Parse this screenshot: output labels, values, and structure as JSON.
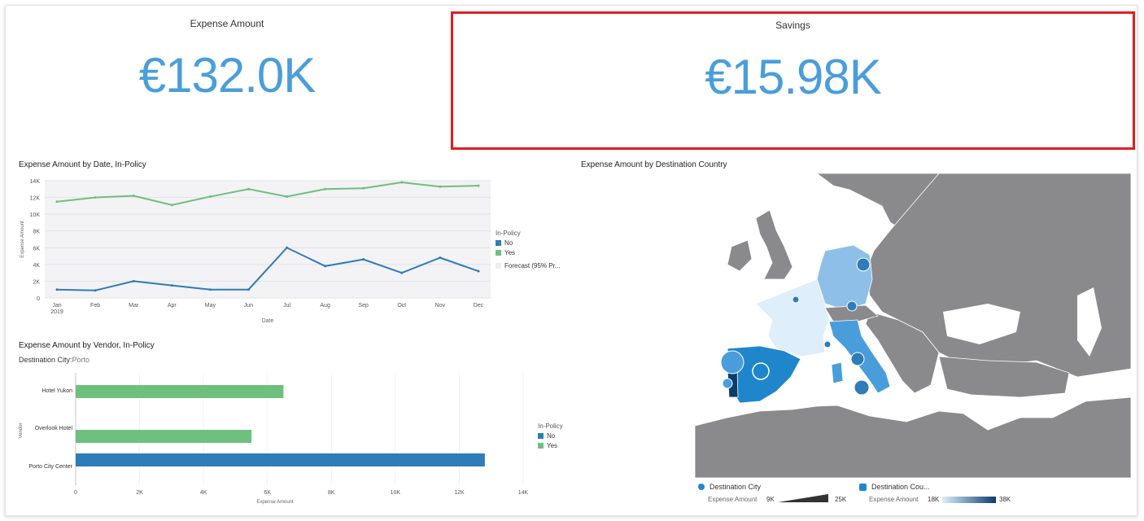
{
  "kpi_expense": {
    "title": "Expense Amount",
    "value": "€132.0K"
  },
  "kpi_savings": {
    "title": "Savings",
    "value": "€15.98K"
  },
  "line_panel": {
    "title": "Expense Amount by Date, In-Policy",
    "legend_title": "In-Policy",
    "legend_no": "No",
    "legend_yes": "Yes",
    "legend_forecast": "Forecast (95% Pr..."
  },
  "bar_panel": {
    "title": "Expense Amount by Vendor, In-Policy",
    "subtitle": "Destination City:",
    "subtitle_value": "Porto",
    "legend_title": "In-Policy",
    "legend_no": "No",
    "legend_yes": "Yes"
  },
  "map_panel": {
    "title": "Expense Amount by Destination Country",
    "legend_city": "Destination City",
    "legend_country": "Destination Cou...",
    "size_label": "Expense Amount",
    "size_min": "9K",
    "size_max": "25K",
    "color_label": "Expense Amount",
    "color_min": "18K",
    "color_max": "38K"
  },
  "colors": {
    "no": "#2e7cb8",
    "yes": "#6fbf7f",
    "accent": "#4a9ddb",
    "highlight": "#e01e24"
  },
  "chart_data": [
    {
      "type": "line",
      "title": "Expense Amount by Date, In-Policy",
      "xlabel": "Date",
      "ylabel": "Expense Amount",
      "categories": [
        "Jan\n2019",
        "Feb",
        "Mar",
        "Apr",
        "May",
        "Jun",
        "Jul",
        "Aug",
        "Sep",
        "Oct",
        "Nov",
        "Dec"
      ],
      "yticks": [
        "0",
        "2K",
        "4K",
        "6K",
        "8K",
        "10K",
        "12K",
        "14K"
      ],
      "ylim": [
        0,
        14000
      ],
      "series": [
        {
          "name": "No",
          "color": "#2e7cb8",
          "values": [
            1000,
            900,
            2000,
            1500,
            1000,
            1000,
            6000,
            3800,
            4600,
            3000,
            4800,
            3200
          ]
        },
        {
          "name": "Yes",
          "color": "#6fbf7f",
          "values": [
            11500,
            12000,
            12200,
            11100,
            12100,
            13000,
            12100,
            13000,
            13100,
            13800,
            13300,
            13400
          ]
        }
      ]
    },
    {
      "type": "bar",
      "orientation": "horizontal",
      "title": "Expense Amount by Vendor, In-Policy",
      "xlabel": "Expense Amount",
      "ylabel": "Vendor",
      "categories": [
        "Hotel Yukon",
        "Overlook Hotel",
        "Porto City Center"
      ],
      "xticks": [
        "0",
        "2K",
        "4K",
        "6K",
        "8K",
        "10K",
        "12K",
        "14K"
      ],
      "xlim": [
        0,
        14000
      ],
      "series": [
        {
          "name": "Yes",
          "color": "#6fbf7f",
          "values": [
            6500,
            5500,
            null
          ]
        },
        {
          "name": "No",
          "color": "#2e7cb8",
          "values": [
            null,
            null,
            12800
          ]
        }
      ]
    }
  ]
}
